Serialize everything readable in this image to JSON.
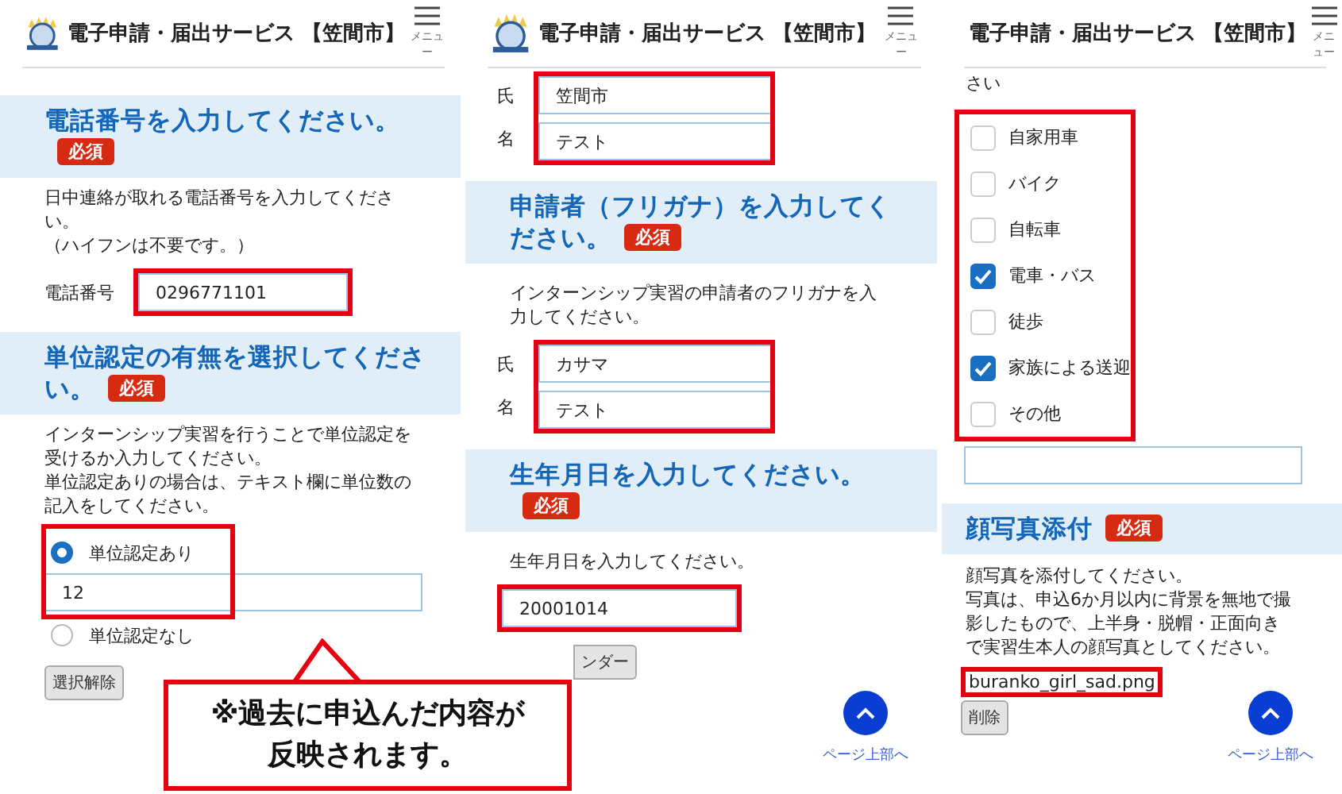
{
  "panels": [
    {
      "header": {
        "title": "電子申請・届出サービス 【笠間市】",
        "menu_label": "メニュー"
      },
      "blocks": [
        {
          "kind": "band",
          "title": "電話番号を入力してください。",
          "badge": "必須"
        },
        {
          "kind": "text",
          "lines": [
            "日中連絡が取れる電話番号を入力してください。",
            "（ハイフンは不要です。）"
          ]
        },
        {
          "kind": "labeled_input",
          "label": "電話番号",
          "value": "0296771101",
          "highlighted": true
        },
        {
          "kind": "band",
          "title": "単位認定の有無を選択してください。",
          "badge": "必須"
        },
        {
          "kind": "text",
          "lines": [
            "インターンシップ実習を行うことで単位認定を受けるか入力してください。",
            "単位認定ありの場合は、テキスト欄に単位数の記入をしてください。"
          ]
        },
        {
          "kind": "radio_group",
          "highlighted": true,
          "options": [
            {
              "label": "単位認定あり",
              "selected": true,
              "value": "12"
            },
            {
              "label": "単位認定なし",
              "selected": false
            }
          ]
        },
        {
          "kind": "button",
          "label": "選択解除"
        }
      ]
    },
    {
      "header": {
        "title": "電子申請・届出サービス 【笠間市】",
        "menu_label": "メニュー"
      },
      "blocks": [
        {
          "kind": "name_inputs",
          "highlighted": true,
          "rows": [
            {
              "label": "氏",
              "value": "笠間市"
            },
            {
              "label": "名",
              "value": "テスト"
            }
          ]
        },
        {
          "kind": "band",
          "title": "申請者（フリガナ）を入力してください。",
          "badge": "必須"
        },
        {
          "kind": "text",
          "lines": [
            "インターンシップ実習の申請者のフリガナを入力してください。"
          ]
        },
        {
          "kind": "name_inputs",
          "highlighted": true,
          "rows": [
            {
              "label": "氏",
              "value": "カサマ"
            },
            {
              "label": "名",
              "value": "テスト"
            }
          ]
        },
        {
          "kind": "band",
          "title": "生年月日を入力してください。",
          "badge": "必須"
        },
        {
          "kind": "text",
          "lines": [
            "生年月日を入力してください。"
          ]
        },
        {
          "kind": "date_input",
          "value": "20001014",
          "highlighted": true,
          "button": "ンダー"
        }
      ],
      "page_top": {
        "label": "ページ上部へ"
      }
    },
    {
      "header": {
        "title": "電子申請・届出サービス 【笠間市】",
        "menu_label": "メニュー"
      },
      "blocks": [
        {
          "kind": "text",
          "lines": [
            "さい"
          ]
        },
        {
          "kind": "checkbox_group",
          "highlighted": true,
          "options": [
            {
              "label": "自家用車",
              "checked": false
            },
            {
              "label": "バイク",
              "checked": false
            },
            {
              "label": "自転車",
              "checked": false
            },
            {
              "label": "電車・バス",
              "checked": true
            },
            {
              "label": "徒歩",
              "checked": false
            },
            {
              "label": "家族による送迎",
              "checked": true
            },
            {
              "label": "その他",
              "checked": false
            }
          ]
        },
        {
          "kind": "empty_input"
        },
        {
          "kind": "band",
          "title": "顔写真添付",
          "badge": "必須"
        },
        {
          "kind": "text",
          "lines": [
            "顔写真を添付してください。",
            "写真は、申込6か月以内に背景を無地で撮影したもので、上半身・脱帽・正面向きで実習生本人の顔写真としてください。"
          ]
        },
        {
          "kind": "file",
          "name": "buranko_girl_sad.png",
          "highlighted": true,
          "button": "削除"
        }
      ],
      "page_top": {
        "label": "ページ上部へ"
      }
    }
  ],
  "callout": {
    "lines": [
      "※過去に申込んだ内容が",
      "反映されます。"
    ]
  }
}
